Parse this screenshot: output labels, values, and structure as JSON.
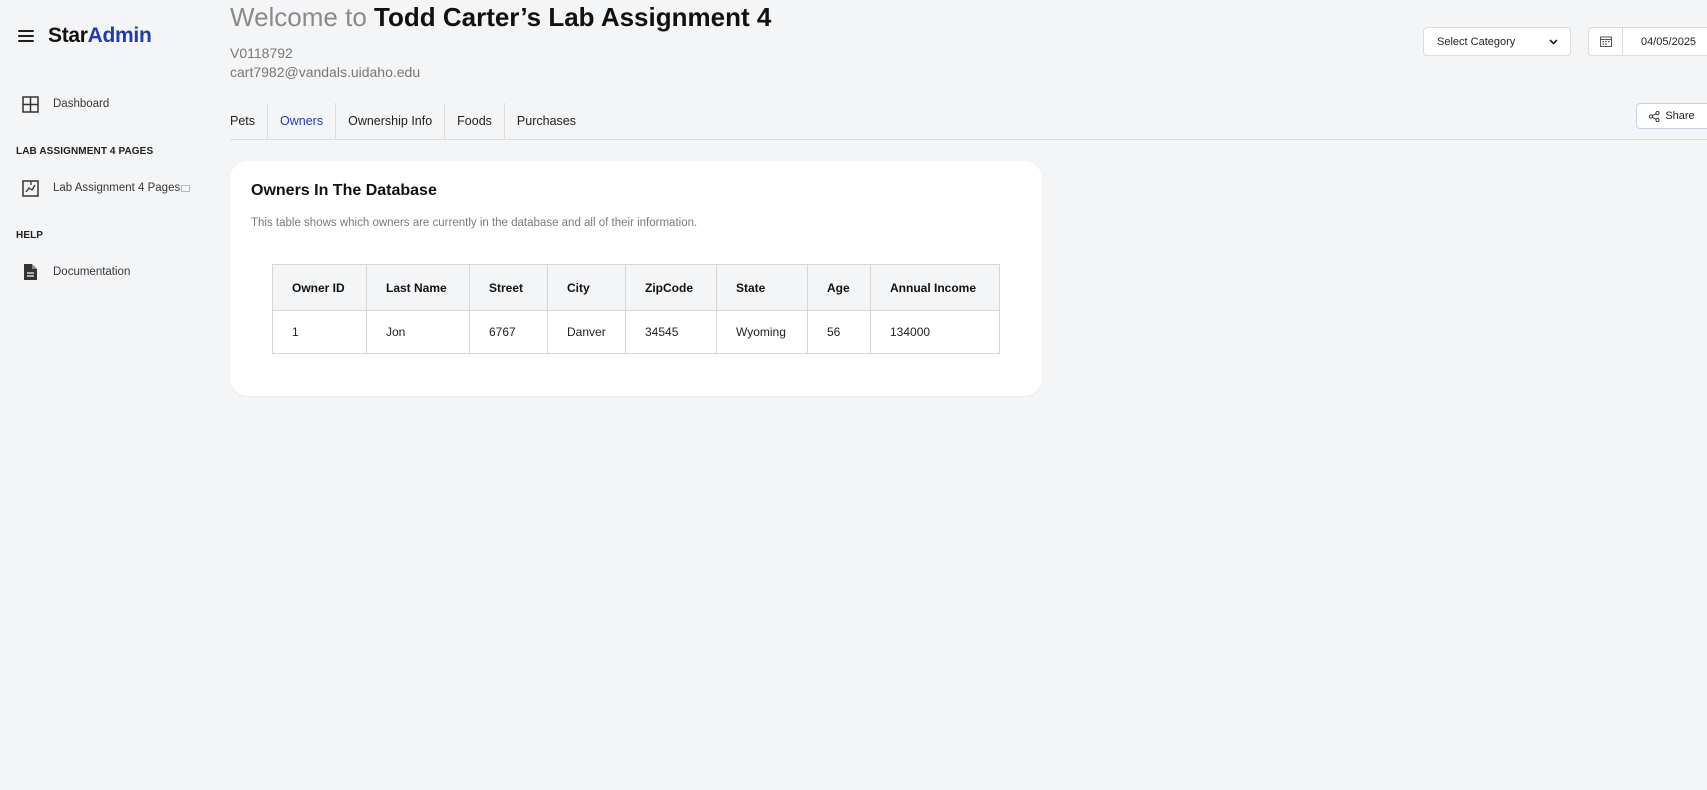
{
  "brand": {
    "star": "Star",
    "admin": "Admin"
  },
  "sidebar": {
    "dashboard": "Dashboard",
    "section_pages": "LAB ASSIGNMENT 4 PAGES",
    "pages_item": "Lab Assignment 4 Pages",
    "section_help": "HELP",
    "documentation": "Documentation"
  },
  "header": {
    "welcome_prefix": "Welcome to ",
    "welcome_name": "Todd Carter’s Lab Assignment 4",
    "student_id": "V0118792",
    "email": "cart7982@vandals.uidaho.edu",
    "category_label": "Select Category",
    "date_value": "04/05/2025",
    "share_label": "Share"
  },
  "tabs": [
    {
      "label": "Pets",
      "active": false
    },
    {
      "label": "Owners",
      "active": true
    },
    {
      "label": "Ownership Info",
      "active": false
    },
    {
      "label": "Foods",
      "active": false
    },
    {
      "label": "Purchases",
      "active": false
    }
  ],
  "card": {
    "title": "Owners In The Database",
    "description": "This table shows which owners are currently in the database and all of their information.",
    "table": {
      "columns": [
        "Owner ID",
        "Last Name",
        "Street",
        "City",
        "ZipCode",
        "State",
        "Age",
        "Annual Income"
      ],
      "rows": [
        [
          "1",
          "Jon",
          "6767",
          "Danver",
          "34545",
          "Wyoming",
          "56",
          "134000"
        ]
      ]
    }
  },
  "colors": {
    "accent": "#1f3bb3",
    "background": "#f4f5f7"
  }
}
